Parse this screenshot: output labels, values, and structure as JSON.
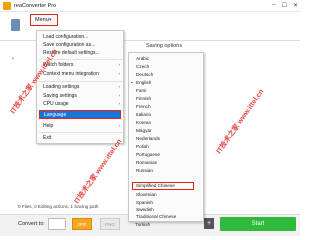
{
  "window": {
    "title": "reaConverter Pro",
    "controls": [
      "–",
      "☐",
      "✕"
    ]
  },
  "toolbar": {
    "menu_label": "Menu"
  },
  "panel": {
    "saving_options_label": "Saving options"
  },
  "main_menu": {
    "items": [
      {
        "label": "Load configuration...",
        "has_submenu": false
      },
      {
        "label": "Save configuration as...",
        "has_submenu": false
      },
      {
        "label": "Restore default settings...",
        "has_submenu": false
      },
      {
        "label": "Watch folders",
        "has_submenu": true
      },
      {
        "label": "Context menu integration",
        "has_submenu": true
      },
      {
        "label": "Loading settings",
        "has_submenu": true
      },
      {
        "label": "Saving settings",
        "has_submenu": true
      },
      {
        "label": "CPU usage",
        "has_submenu": true
      },
      {
        "label": "Language",
        "has_submenu": true,
        "highlighted": true
      },
      {
        "label": "Help",
        "has_submenu": true
      },
      {
        "label": "Exit",
        "has_submenu": false
      }
    ]
  },
  "language_menu": {
    "selected": "English",
    "highlighted": "Simplified Chinese",
    "items": [
      "Arabic",
      "Czech",
      "Deutsch",
      "English",
      "Farsi",
      "Finnish",
      "French",
      "Italiano",
      "Korean",
      "Magyar",
      "Nederlands",
      "Polish",
      "Portuguese",
      "Romanian",
      "Russian",
      "Simplified Chinese",
      "Slovenian",
      "Spanish",
      "Swedish",
      "Traditional Chinese",
      "Turkish"
    ]
  },
  "status": {
    "text": "0 Files, 0 Editing actions, 1 Saving path"
  },
  "bottom": {
    "convert_label": "Convert to:",
    "format_primary": "JPG",
    "format_secondary": "PNG",
    "add_label": "+",
    "start_label": "Start"
  },
  "watermarks": [
    "IT技术之家 www.ittel.cn",
    "IT技术之家 www.ittel.cn",
    "IT技术之家 www.ittel.cn"
  ],
  "colors": {
    "highlight_red": "#e2231a",
    "accent_blue": "#1a73d9",
    "start_green": "#2fba3b",
    "format_orange": "#f5a623"
  }
}
